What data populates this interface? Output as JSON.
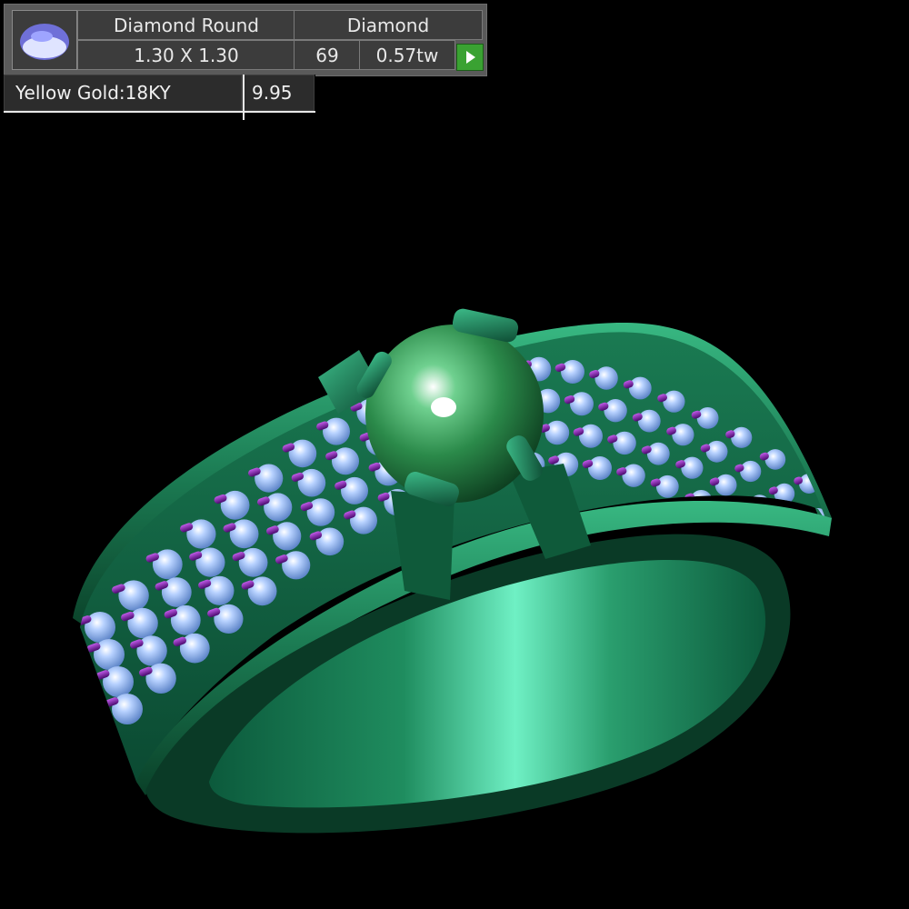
{
  "stone": {
    "shape": "Diamond Round",
    "type": "Diamond",
    "size": "1.30 X 1.30",
    "count": "69",
    "weight": "0.57tw",
    "thumbnail_icon": "round-diamond-icon",
    "play_icon": "play-icon"
  },
  "metal": {
    "name": "Yellow Gold:18KY",
    "weight": "9.95"
  },
  "colors": {
    "ring_body": "#1f8a5a",
    "pave_stones": "#9fbff0",
    "prongs": "#7a1fa6",
    "accent_button": "#3aa232"
  }
}
